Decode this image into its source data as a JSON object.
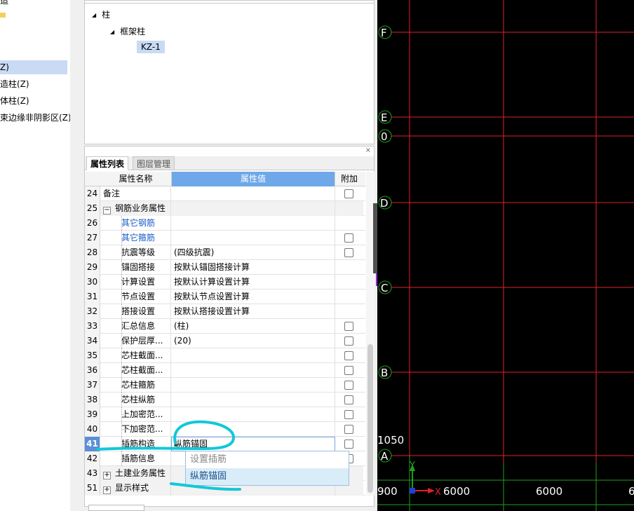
{
  "left_tree": {
    "top_partial": "造",
    "items": [
      {
        "label": "Z)",
        "selected": true
      },
      {
        "label": "造柱(Z)",
        "selected": false
      },
      {
        "label": "体柱(Z)",
        "selected": false
      },
      {
        "label": "束边缘非阴影区(Z)",
        "selected": false
      }
    ]
  },
  "component_tree": {
    "root": "柱",
    "child": "框架柱",
    "leaf": "KZ-1"
  },
  "properties": {
    "close_glyph": "×",
    "tabs": [
      {
        "label": "属性列表",
        "active": true
      },
      {
        "label": "图层管理",
        "active": false
      }
    ],
    "columns": {
      "name": "属性名称",
      "value": "属性值",
      "extra": "附加"
    },
    "rows": [
      {
        "num": "24",
        "name": "备注",
        "value": "",
        "checkbox": true,
        "kind": "plain"
      },
      {
        "num": "25",
        "name": "钢筋业务属性",
        "value": "",
        "checkbox": false,
        "kind": "group",
        "expander": "−"
      },
      {
        "num": "26",
        "name": "其它钢筋",
        "value": "",
        "checkbox": false,
        "kind": "blue"
      },
      {
        "num": "27",
        "name": "其它箍筋",
        "value": "",
        "checkbox": true,
        "kind": "blue"
      },
      {
        "num": "28",
        "name": "抗震等级",
        "value": "(四级抗震)",
        "checkbox": true,
        "kind": "child"
      },
      {
        "num": "29",
        "name": "锚固搭接",
        "value": "按默认锚固搭接计算",
        "checkbox": false,
        "kind": "child"
      },
      {
        "num": "30",
        "name": "计算设置",
        "value": "按默认计算设置计算",
        "checkbox": false,
        "kind": "child"
      },
      {
        "num": "31",
        "name": "节点设置",
        "value": "按默认节点设置计算",
        "checkbox": false,
        "kind": "child"
      },
      {
        "num": "32",
        "name": "搭接设置",
        "value": "按默认搭接设置计算",
        "checkbox": false,
        "kind": "child"
      },
      {
        "num": "33",
        "name": "汇总信息",
        "value": "(柱)",
        "checkbox": true,
        "kind": "child"
      },
      {
        "num": "34",
        "name": "保护层厚...",
        "value": "(20)",
        "checkbox": true,
        "kind": "child"
      },
      {
        "num": "35",
        "name": "芯柱截面...",
        "value": "",
        "checkbox": true,
        "kind": "child"
      },
      {
        "num": "36",
        "name": "芯柱截面...",
        "value": "",
        "checkbox": true,
        "kind": "child"
      },
      {
        "num": "37",
        "name": "芯柱箍筋",
        "value": "",
        "checkbox": true,
        "kind": "child"
      },
      {
        "num": "38",
        "name": "芯柱纵筋",
        "value": "",
        "checkbox": true,
        "kind": "child"
      },
      {
        "num": "39",
        "name": "上加密范...",
        "value": "",
        "checkbox": true,
        "kind": "child"
      },
      {
        "num": "40",
        "name": "下加密范...",
        "value": "",
        "checkbox": true,
        "kind": "child"
      },
      {
        "num": "41",
        "name": "插筋构造",
        "value": "纵筋锚固",
        "checkbox": true,
        "kind": "active"
      },
      {
        "num": "42",
        "name": "插筋信息",
        "value": "",
        "checkbox": true,
        "kind": "child"
      },
      {
        "num": "43",
        "name": "土建业务属性",
        "value": "",
        "checkbox": false,
        "kind": "group",
        "expander": "+"
      },
      {
        "num": "51",
        "name": "显示样式",
        "value": "",
        "checkbox": false,
        "kind": "group",
        "expander": "+"
      }
    ],
    "dropdown": {
      "options": [
        "设置插筋",
        "纵筋锚固"
      ],
      "selected": "纵筋锚固",
      "arrow": "▲"
    }
  },
  "cad": {
    "axis_labels": [
      "F",
      "E",
      "0",
      "D",
      "C",
      "B",
      "A"
    ],
    "dimension_labels": [
      "1050",
      "900",
      "6000",
      "6000",
      "6"
    ],
    "ucs": {
      "y": "Y",
      "x": "X"
    },
    "grid_color": "#e0202a",
    "dim_color": "#1fa01f",
    "background": "#000000"
  }
}
